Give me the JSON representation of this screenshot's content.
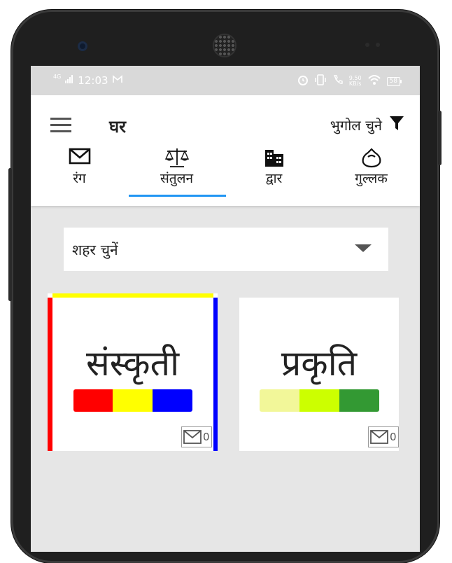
{
  "status_bar": {
    "network": "4G",
    "time": "12:03",
    "speed_top": "9.50",
    "speed_bottom": "KB/s",
    "battery": "58"
  },
  "app_bar": {
    "title": "घर",
    "geo_filter_label": "भुगोल चुने"
  },
  "tabs": [
    {
      "label": "रंग",
      "icon": "envelope-icon"
    },
    {
      "label": "संतुलन",
      "icon": "scale-icon"
    },
    {
      "label": "द्वार",
      "icon": "building-icon"
    },
    {
      "label": "गुल्लक",
      "icon": "piggy-bank-icon"
    }
  ],
  "selected_tab": "संतुलन",
  "city_select": {
    "value": "शहर चुनें"
  },
  "cards": [
    {
      "name": "संस्कृती",
      "colors": [
        "#ff0000",
        "#ffff00",
        "#0000ff"
      ],
      "message_count": "0",
      "border_colors": {
        "left": "#ff0000",
        "top": "#ffff00",
        "right": "#0000ff"
      }
    },
    {
      "name": "प्रकृति",
      "colors": [
        "#f2f799",
        "#ccff00",
        "#339933"
      ],
      "message_count": "0"
    }
  ]
}
